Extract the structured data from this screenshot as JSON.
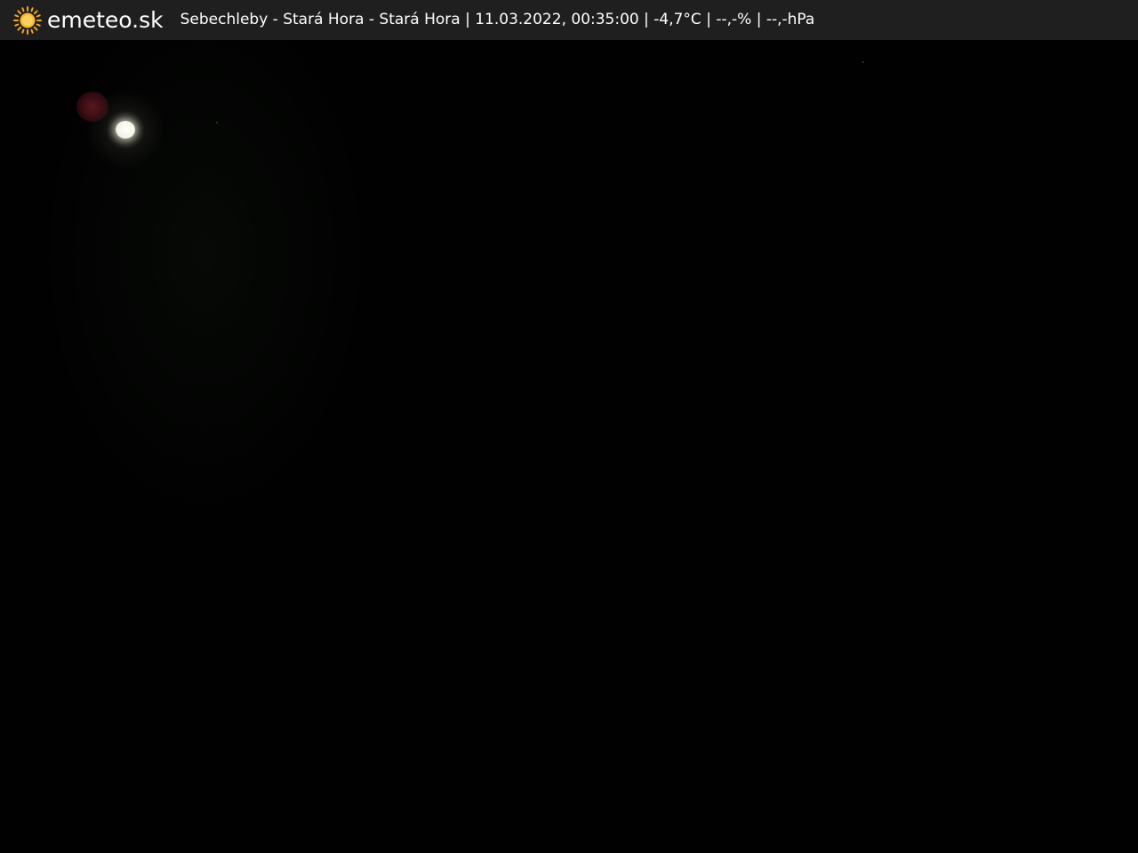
{
  "brand": {
    "name": "emeteo.sk",
    "icon": "sun-icon",
    "icon_color": "#f5a623"
  },
  "caption": "Sebechleby - Stará Hora - Stará Hora | 11.03.2022, 00:35:00 | -4,7°C | --,-% | --,-hPa",
  "colors": {
    "topbar": "#1f1f1f",
    "background": "#010101"
  }
}
